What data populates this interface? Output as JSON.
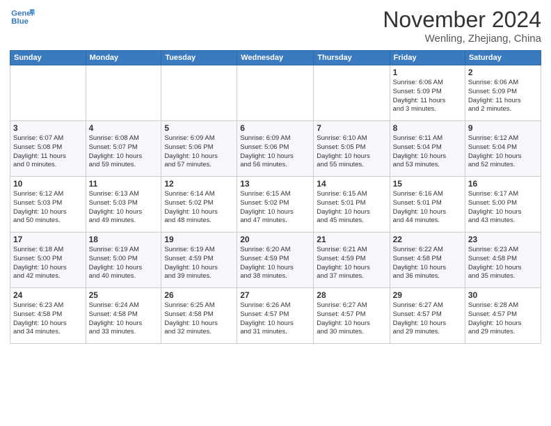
{
  "logo": {
    "line1": "General",
    "line2": "Blue"
  },
  "title": "November 2024",
  "subtitle": "Wenling, Zhejiang, China",
  "weekdays": [
    "Sunday",
    "Monday",
    "Tuesday",
    "Wednesday",
    "Thursday",
    "Friday",
    "Saturday"
  ],
  "weeks": [
    [
      {
        "day": "",
        "info": ""
      },
      {
        "day": "",
        "info": ""
      },
      {
        "day": "",
        "info": ""
      },
      {
        "day": "",
        "info": ""
      },
      {
        "day": "",
        "info": ""
      },
      {
        "day": "1",
        "info": "Sunrise: 6:06 AM\nSunset: 5:09 PM\nDaylight: 11 hours\nand 3 minutes."
      },
      {
        "day": "2",
        "info": "Sunrise: 6:06 AM\nSunset: 5:09 PM\nDaylight: 11 hours\nand 2 minutes."
      }
    ],
    [
      {
        "day": "3",
        "info": "Sunrise: 6:07 AM\nSunset: 5:08 PM\nDaylight: 11 hours\nand 0 minutes."
      },
      {
        "day": "4",
        "info": "Sunrise: 6:08 AM\nSunset: 5:07 PM\nDaylight: 10 hours\nand 59 minutes."
      },
      {
        "day": "5",
        "info": "Sunrise: 6:09 AM\nSunset: 5:06 PM\nDaylight: 10 hours\nand 57 minutes."
      },
      {
        "day": "6",
        "info": "Sunrise: 6:09 AM\nSunset: 5:06 PM\nDaylight: 10 hours\nand 56 minutes."
      },
      {
        "day": "7",
        "info": "Sunrise: 6:10 AM\nSunset: 5:05 PM\nDaylight: 10 hours\nand 55 minutes."
      },
      {
        "day": "8",
        "info": "Sunrise: 6:11 AM\nSunset: 5:04 PM\nDaylight: 10 hours\nand 53 minutes."
      },
      {
        "day": "9",
        "info": "Sunrise: 6:12 AM\nSunset: 5:04 PM\nDaylight: 10 hours\nand 52 minutes."
      }
    ],
    [
      {
        "day": "10",
        "info": "Sunrise: 6:12 AM\nSunset: 5:03 PM\nDaylight: 10 hours\nand 50 minutes."
      },
      {
        "day": "11",
        "info": "Sunrise: 6:13 AM\nSunset: 5:03 PM\nDaylight: 10 hours\nand 49 minutes."
      },
      {
        "day": "12",
        "info": "Sunrise: 6:14 AM\nSunset: 5:02 PM\nDaylight: 10 hours\nand 48 minutes."
      },
      {
        "day": "13",
        "info": "Sunrise: 6:15 AM\nSunset: 5:02 PM\nDaylight: 10 hours\nand 47 minutes."
      },
      {
        "day": "14",
        "info": "Sunrise: 6:15 AM\nSunset: 5:01 PM\nDaylight: 10 hours\nand 45 minutes."
      },
      {
        "day": "15",
        "info": "Sunrise: 6:16 AM\nSunset: 5:01 PM\nDaylight: 10 hours\nand 44 minutes."
      },
      {
        "day": "16",
        "info": "Sunrise: 6:17 AM\nSunset: 5:00 PM\nDaylight: 10 hours\nand 43 minutes."
      }
    ],
    [
      {
        "day": "17",
        "info": "Sunrise: 6:18 AM\nSunset: 5:00 PM\nDaylight: 10 hours\nand 42 minutes."
      },
      {
        "day": "18",
        "info": "Sunrise: 6:19 AM\nSunset: 5:00 PM\nDaylight: 10 hours\nand 40 minutes."
      },
      {
        "day": "19",
        "info": "Sunrise: 6:19 AM\nSunset: 4:59 PM\nDaylight: 10 hours\nand 39 minutes."
      },
      {
        "day": "20",
        "info": "Sunrise: 6:20 AM\nSunset: 4:59 PM\nDaylight: 10 hours\nand 38 minutes."
      },
      {
        "day": "21",
        "info": "Sunrise: 6:21 AM\nSunset: 4:59 PM\nDaylight: 10 hours\nand 37 minutes."
      },
      {
        "day": "22",
        "info": "Sunrise: 6:22 AM\nSunset: 4:58 PM\nDaylight: 10 hours\nand 36 minutes."
      },
      {
        "day": "23",
        "info": "Sunrise: 6:23 AM\nSunset: 4:58 PM\nDaylight: 10 hours\nand 35 minutes."
      }
    ],
    [
      {
        "day": "24",
        "info": "Sunrise: 6:23 AM\nSunset: 4:58 PM\nDaylight: 10 hours\nand 34 minutes."
      },
      {
        "day": "25",
        "info": "Sunrise: 6:24 AM\nSunset: 4:58 PM\nDaylight: 10 hours\nand 33 minutes."
      },
      {
        "day": "26",
        "info": "Sunrise: 6:25 AM\nSunset: 4:58 PM\nDaylight: 10 hours\nand 32 minutes."
      },
      {
        "day": "27",
        "info": "Sunrise: 6:26 AM\nSunset: 4:57 PM\nDaylight: 10 hours\nand 31 minutes."
      },
      {
        "day": "28",
        "info": "Sunrise: 6:27 AM\nSunset: 4:57 PM\nDaylight: 10 hours\nand 30 minutes."
      },
      {
        "day": "29",
        "info": "Sunrise: 6:27 AM\nSunset: 4:57 PM\nDaylight: 10 hours\nand 29 minutes."
      },
      {
        "day": "30",
        "info": "Sunrise: 6:28 AM\nSunset: 4:57 PM\nDaylight: 10 hours\nand 29 minutes."
      }
    ]
  ]
}
